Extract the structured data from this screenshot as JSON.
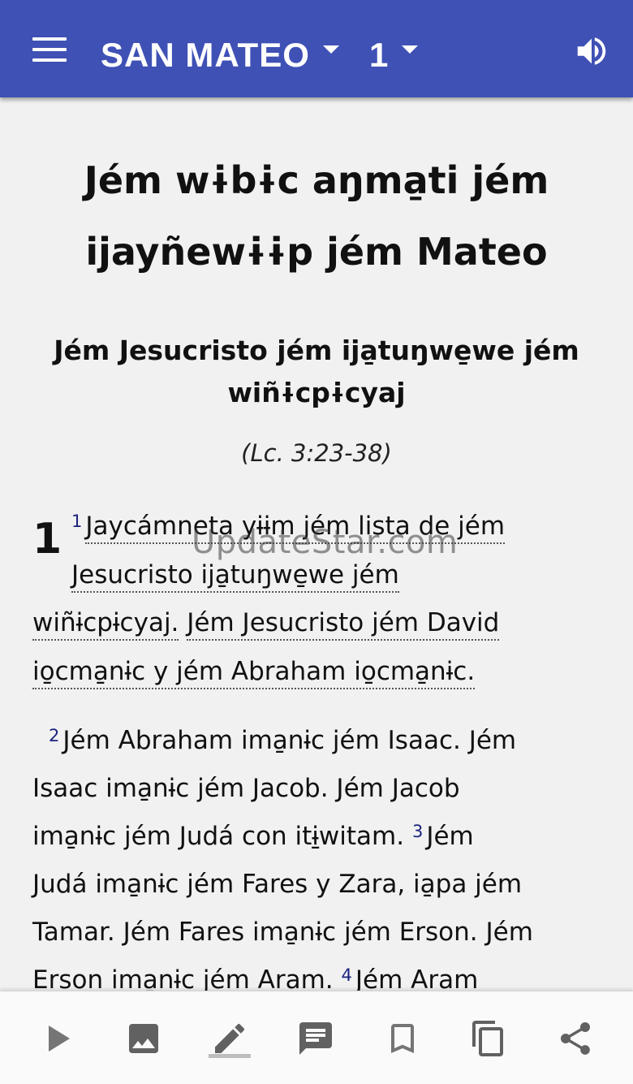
{
  "header": {
    "book": "SAN MATEO",
    "chapter": "1"
  },
  "content": {
    "title_line1": "Jém wɨbɨc aŋma̱ti jém",
    "title_line2": "ijayñewɨɨp jém Mateo",
    "section_heading_line1": "Jém Jesucristo jém ija̱tuŋwe̱we jém",
    "section_heading_line2": "wiñɨcpɨcyaj",
    "section_ref": "(Lc. 3:23-38)",
    "chapter_number": "1",
    "verse1": {
      "number": "1",
      "line1": "Jaycámneta yɨɨm jém lista de jém",
      "line2": "Jesucristo ija̱tuŋwe̱we jém",
      "line3a": "wiñɨcpɨcyaj.",
      "line3b": "Jém Jesucristo jém David",
      "line4": "io̱cma̱nɨc y jém Abraham io̱cma̱nɨc."
    },
    "verse2": {
      "number": "2",
      "line1": "Jém Abraham ima̱nɨc jém Isaac. Jém",
      "line2": "Isaac ima̱nɨc jém Jacob. Jém Jacob",
      "line3": "ima̱nɨc jém Judá con itɨ̱witam."
    },
    "verse3": {
      "number": "3",
      "line1": "Jém",
      "line2": "Judá ima̱nɨc jém Fares y Zara, ia̱pa jém",
      "line3": "Tamar. Jém Fares ima̱nɨc jém Erson. Jém",
      "line4": "Erson ima̱nɨc jém Aram."
    },
    "verse4": {
      "number": "4",
      "line1": "Jém Aram"
    }
  },
  "watermark": "UpdateStar.com",
  "colors": {
    "app_bar": "#3f51b5",
    "verse_number": "#1a237e",
    "background": "#f1f1f1"
  },
  "bottom_bar": [
    "play-icon",
    "image-icon",
    "pencil-icon",
    "comment-icon",
    "bookmark-icon",
    "copy-icon",
    "share-icon"
  ]
}
